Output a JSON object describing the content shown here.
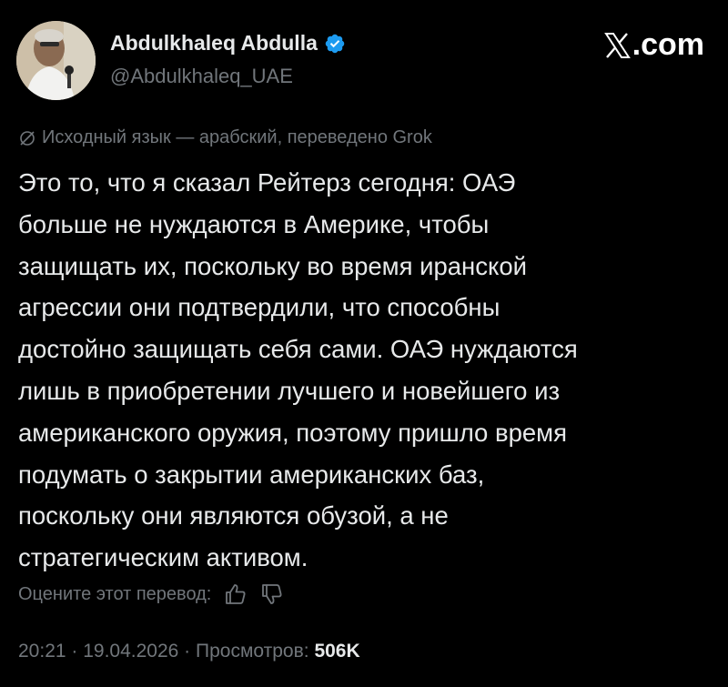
{
  "site": {
    "logo_text": ".com"
  },
  "author": {
    "display_name": "Abdulkhaleq Abdulla",
    "handle": "@Abdulkhaleq_UAE",
    "verified": true,
    "verified_color": "#1d9bf0"
  },
  "translation": {
    "note": "Исходный язык — арабский, переведено Grok",
    "icon": "globe-icon"
  },
  "tweet": {
    "lines": [
      "Это то, что я сказал Рейтерз сегодня: ОАЭ",
      "больше не нуждаются в Америке, чтобы",
      "защищать их, поскольку во время иранской",
      "агрессии они подтвердили, что способны",
      "достойно защищать себя сами. ОАЭ нуждаются",
      "лишь в приобретении лучшего и новейшего из",
      "американского оружия, поэтому пришло время",
      "подумать о закрытии американских баз,",
      "поскольку они являются обузой, а не",
      "стратегическим активом."
    ]
  },
  "rating": {
    "label": "Оцените этот перевод:",
    "thumbs_up_icon": "thumbs-up-icon",
    "thumbs_down_icon": "thumbs-down-icon"
  },
  "meta": {
    "time": "20:21",
    "separator": " · ",
    "date": "19.04.2026",
    "views_label": "Просмотров:",
    "views_count": "506K"
  },
  "colors": {
    "background": "#000000",
    "text": "#e7e9ea",
    "secondary": "#71767b"
  }
}
